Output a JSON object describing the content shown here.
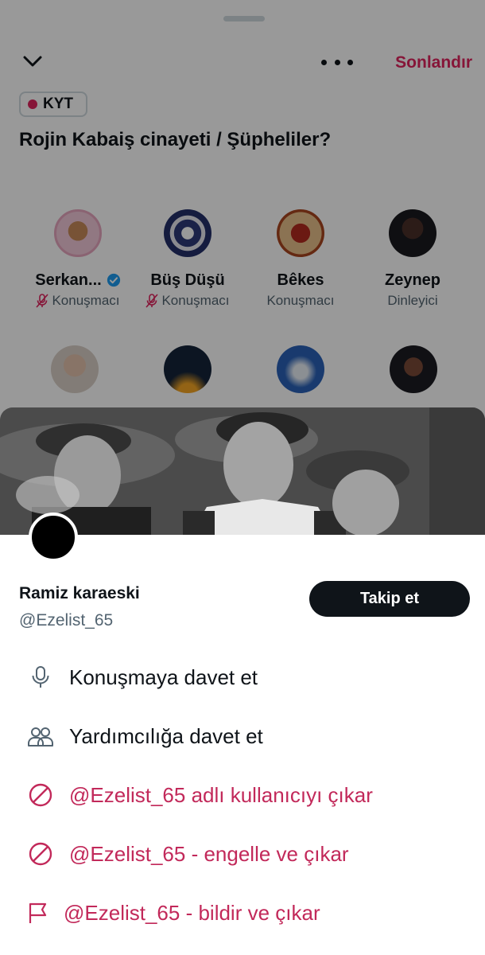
{
  "header": {
    "end_label": "Sonlandır"
  },
  "space": {
    "tag": "KYT",
    "title": "Rojin Kabaiş cinayeti / Şüpheliler?",
    "participants": [
      {
        "name": "Serkan...",
        "role": "Konuşmacı",
        "verified": true,
        "muted": true
      },
      {
        "name": "Büş Düşü",
        "role": "Konuşmacı",
        "verified": false,
        "muted": true
      },
      {
        "name": "Bêkes",
        "role": "Konuşmacı",
        "verified": false,
        "muted": false
      },
      {
        "name": "Zeynep",
        "role": "Dinleyici",
        "verified": false,
        "muted": false
      }
    ]
  },
  "profile": {
    "name": "Ramiz karaeski",
    "handle": "@Ezelist_65",
    "follow_label": "Takip et",
    "actions": [
      {
        "label": "Konuşmaya davet et",
        "icon": "microphone-icon"
      },
      {
        "label": "Yardımcılığa davet et",
        "icon": "people-icon"
      },
      {
        "label": "@Ezelist_65 adlı kullanıcıyı çıkar",
        "icon": "block-icon"
      },
      {
        "label": "@Ezelist_65 - engelle ve çıkar",
        "icon": "block-icon"
      },
      {
        "label": "@Ezelist_65 - bildir ve çıkar",
        "icon": "flag-icon"
      }
    ]
  },
  "colors": {
    "accent_red": "#e0245e",
    "danger_text": "#c2295a",
    "follow_button": "#0f1419",
    "verified_blue": "#1d9bf0"
  }
}
